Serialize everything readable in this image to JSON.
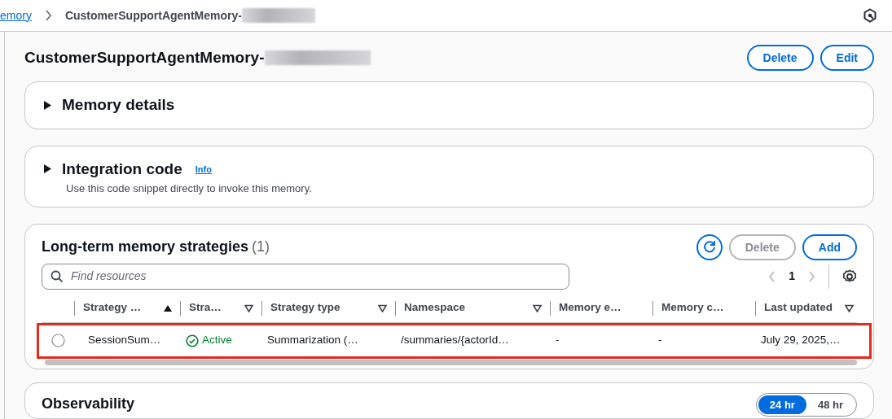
{
  "breadcrumbs": [
    {
      "label": "emory",
      "link": true
    },
    {
      "label": "CustomerSupportAgentMemory-",
      "link": false,
      "redacted": true
    }
  ],
  "header": {
    "title": "CustomerSupportAgentMemory-",
    "redacted": true,
    "buttons": [
      "Delete",
      "Edit"
    ]
  },
  "sections": [
    {
      "title": "Memory details",
      "expanded": false
    },
    {
      "title": "Integration code",
      "expanded": false,
      "info": "Info",
      "description": "Use this code snippet directly to invoke this memory."
    }
  ],
  "strategies": {
    "title": "Long-term memory strategies",
    "count": "(1)",
    "buttons": [
      {
        "label": "Delete",
        "disabled": true
      },
      {
        "label": "Add",
        "disabled": false
      }
    ],
    "search": {
      "placeholder": "Find resources"
    },
    "page": "1",
    "columns": [
      {
        "label": "Strategy …",
        "sortable": true,
        "sorted": true
      },
      {
        "label": "Stra…",
        "sortable": true,
        "sorted": false
      },
      {
        "label": "Strategy type",
        "sortable": true,
        "sorted": false
      },
      {
        "label": "Namespace",
        "sortable": true,
        "sorted": false
      },
      {
        "label": "Memory e…",
        "sortable": false
      },
      {
        "label": "Memory c…",
        "sortable": false
      },
      {
        "label": "Last updated",
        "sortable": true,
        "sorted": false
      }
    ],
    "rows": [
      {
        "selected": false,
        "highlighted": true,
        "cells": [
          {
            "kind": "text",
            "text": "SessionSum…"
          },
          {
            "kind": "status",
            "text": "Active"
          },
          {
            "kind": "text",
            "text": "Summarization (…"
          },
          {
            "kind": "text",
            "text": "/summaries/{actorId…"
          },
          {
            "kind": "text",
            "text": "-"
          },
          {
            "kind": "text",
            "text": "-"
          },
          {
            "kind": "text",
            "text": "July 29, 2025,…"
          }
        ]
      }
    ]
  },
  "observability": {
    "title": "Observability",
    "ranges": [
      {
        "label": "24 hr",
        "selected": true
      },
      {
        "label": "48 hr",
        "selected": false
      }
    ]
  }
}
